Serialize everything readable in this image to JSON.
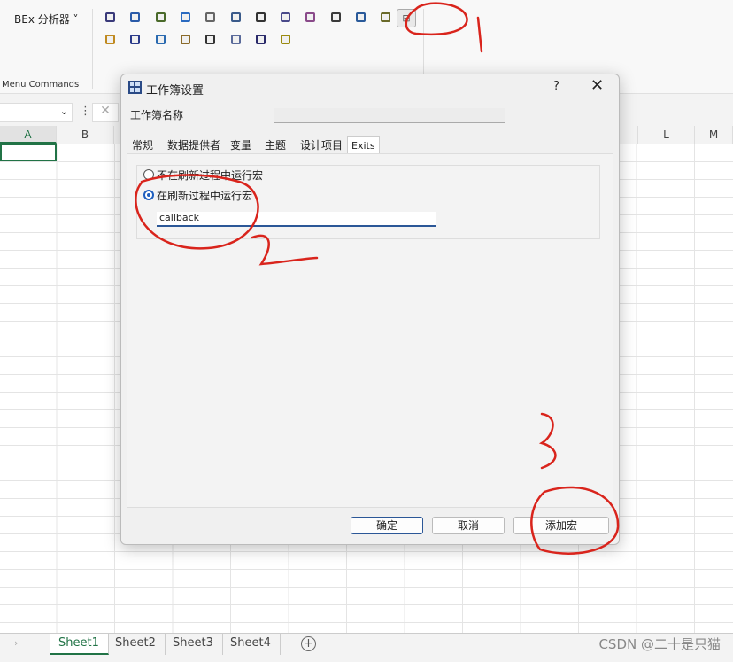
{
  "ribbon": {
    "bex_label": "BEx 分析器 ˅",
    "group_label": "Menu Commands",
    "selected_icon": "workbook-settings-icon"
  },
  "columns": [
    "A",
    "B",
    "L",
    "M"
  ],
  "dialog": {
    "title": "工作簿设置",
    "help": "?",
    "close": "✕",
    "name_label": "工作簿名称",
    "name_value": "",
    "tabs": [
      "常规",
      "数据提供者",
      "变量",
      "主题",
      "设计项目",
      "Exits"
    ],
    "active_tab": "Exits",
    "options": [
      {
        "label": "不在刷新过程中运行宏",
        "selected": false
      },
      {
        "label": "在刷新过程中运行宏",
        "selected": true
      }
    ],
    "macro_value": "callback",
    "buttons": {
      "ok": "确定",
      "cancel": "取消",
      "add_macro": "添加宏"
    }
  },
  "sheets": [
    "Sheet1",
    "Sheet2",
    "Sheet3",
    "Sheet4"
  ],
  "active_sheet": "Sheet1",
  "watermark": "CSDN @二十是只猫",
  "annotations": [
    "1",
    "2",
    "3"
  ],
  "colors": {
    "annotation": "#d9241c",
    "excel_green": "#217346",
    "accent": "#1f5fbf"
  }
}
